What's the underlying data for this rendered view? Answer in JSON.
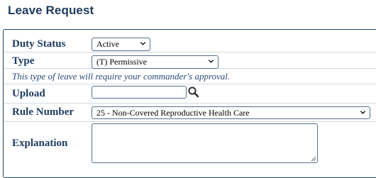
{
  "page": {
    "title": "Leave Request"
  },
  "form": {
    "duty_status": {
      "label": "Duty Status",
      "value": "Active"
    },
    "type": {
      "label": "Type",
      "value": "(T) Permissive"
    },
    "type_note": "This type of leave will require your commander's approval.",
    "upload": {
      "label": "Upload",
      "value": ""
    },
    "rule_number": {
      "label": "Rule Number",
      "value": "25 - Non-Covered Reproductive Health Care"
    },
    "explanation": {
      "label": "Explanation",
      "value": ""
    }
  },
  "icons": {
    "upload_search": "magnifier-icon",
    "select_toggle": "chevron-down-icon"
  }
}
